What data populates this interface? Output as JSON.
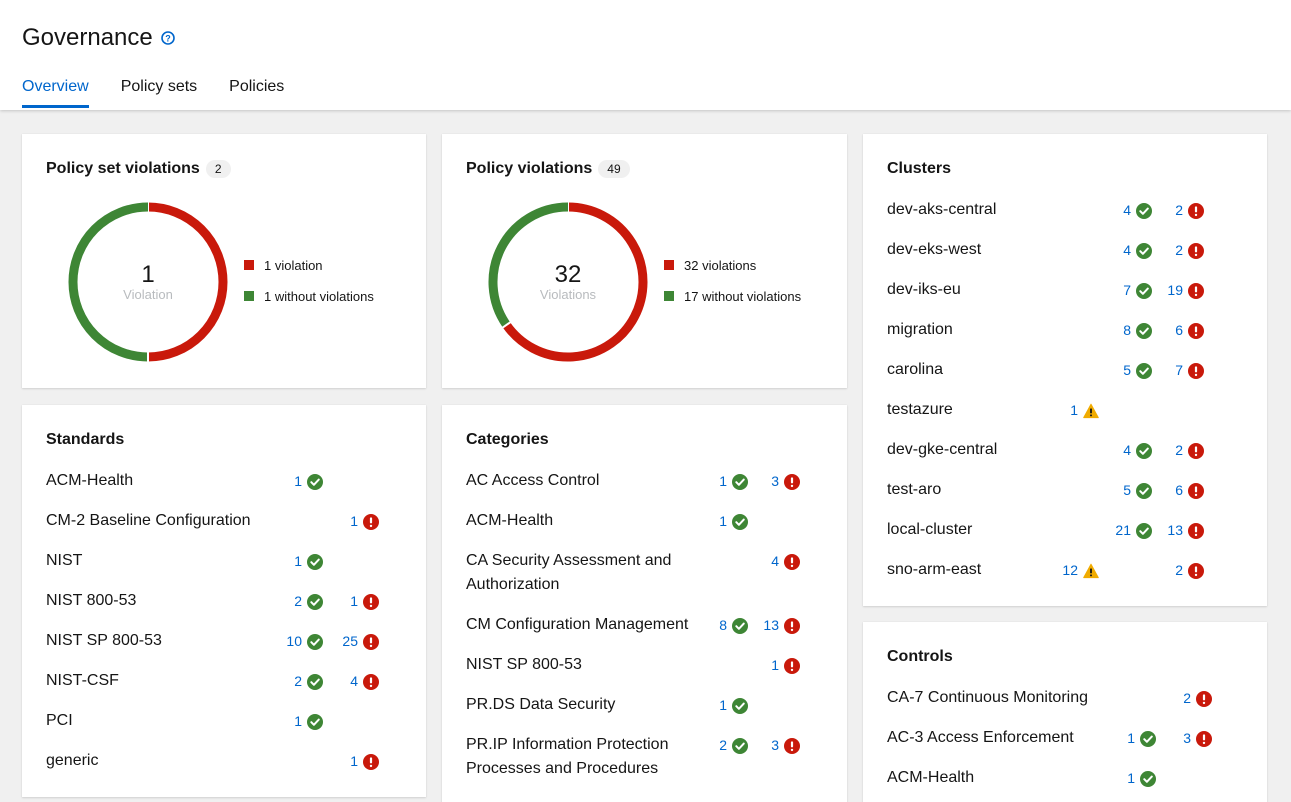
{
  "header": {
    "title": "Governance",
    "tabs": [
      {
        "label": "Overview",
        "active": true
      },
      {
        "label": "Policy sets",
        "active": false
      },
      {
        "label": "Policies",
        "active": false
      }
    ]
  },
  "colors": {
    "violation": "#c9190b",
    "ok": "#3e8635",
    "warning": "#f0ab00",
    "link": "#0066cc"
  },
  "policy_set_violations": {
    "title": "Policy set violations",
    "badge": "2",
    "center_value": "1",
    "center_label": "Violation",
    "violations": 1,
    "without": 1,
    "legend": [
      "1 violation",
      "1 without violations"
    ]
  },
  "policy_violations": {
    "title": "Policy violations",
    "badge": "49",
    "center_value": "32",
    "center_label": "Violations",
    "violations": 32,
    "without": 17,
    "legend": [
      "32 violations",
      "17 without violations"
    ]
  },
  "clusters": {
    "title": "Clusters",
    "items": [
      {
        "name": "dev-aks-central",
        "ok": "4",
        "bad": "2"
      },
      {
        "name": "dev-eks-west",
        "ok": "4",
        "bad": "2"
      },
      {
        "name": "dev-iks-eu",
        "ok": "7",
        "bad": "19"
      },
      {
        "name": "migration",
        "ok": "8",
        "bad": "6"
      },
      {
        "name": "carolina",
        "ok": "5",
        "bad": "7"
      },
      {
        "name": "testazure",
        "warn": "1"
      },
      {
        "name": "dev-gke-central",
        "ok": "4",
        "bad": "2"
      },
      {
        "name": "test-aro",
        "ok": "5",
        "bad": "6"
      },
      {
        "name": "local-cluster",
        "ok": "21",
        "bad": "13"
      },
      {
        "name": "sno-arm-east",
        "warn": "12",
        "bad": "2"
      }
    ]
  },
  "standards": {
    "title": "Standards",
    "items": [
      {
        "name": "ACM-Health",
        "ok": "1"
      },
      {
        "name": "CM-2 Baseline Configuration",
        "bad": "1"
      },
      {
        "name": "NIST",
        "ok": "1"
      },
      {
        "name": "NIST 800-53",
        "ok": "2",
        "bad": "1"
      },
      {
        "name": "NIST SP 800-53",
        "ok": "10",
        "bad": "25"
      },
      {
        "name": "NIST-CSF",
        "ok": "2",
        "bad": "4"
      },
      {
        "name": "PCI",
        "ok": "1"
      },
      {
        "name": "generic",
        "bad": "1"
      }
    ]
  },
  "categories": {
    "title": "Categories",
    "items": [
      {
        "name": "AC Access Control",
        "ok": "1",
        "bad": "3"
      },
      {
        "name": "ACM-Health",
        "ok": "1"
      },
      {
        "name": "CA Security Assessment and Authorization",
        "bad": "4",
        "lines": 2
      },
      {
        "name": "CM Configuration Management",
        "ok": "8",
        "bad": "13"
      },
      {
        "name": "NIST SP 800-53",
        "bad": "1"
      },
      {
        "name": "PR.DS Data Security",
        "ok": "1"
      },
      {
        "name": "PR.IP Information Protection Processes and Procedures",
        "ok": "2",
        "bad": "3",
        "lines": 2
      }
    ]
  },
  "controls": {
    "title": "Controls",
    "items": [
      {
        "name": "CA-7 Continuous Monitoring",
        "bad": "2"
      },
      {
        "name": "AC-3 Access Enforcement",
        "ok": "1",
        "bad": "3"
      },
      {
        "name": "ACM-Health",
        "ok": "1"
      }
    ]
  }
}
